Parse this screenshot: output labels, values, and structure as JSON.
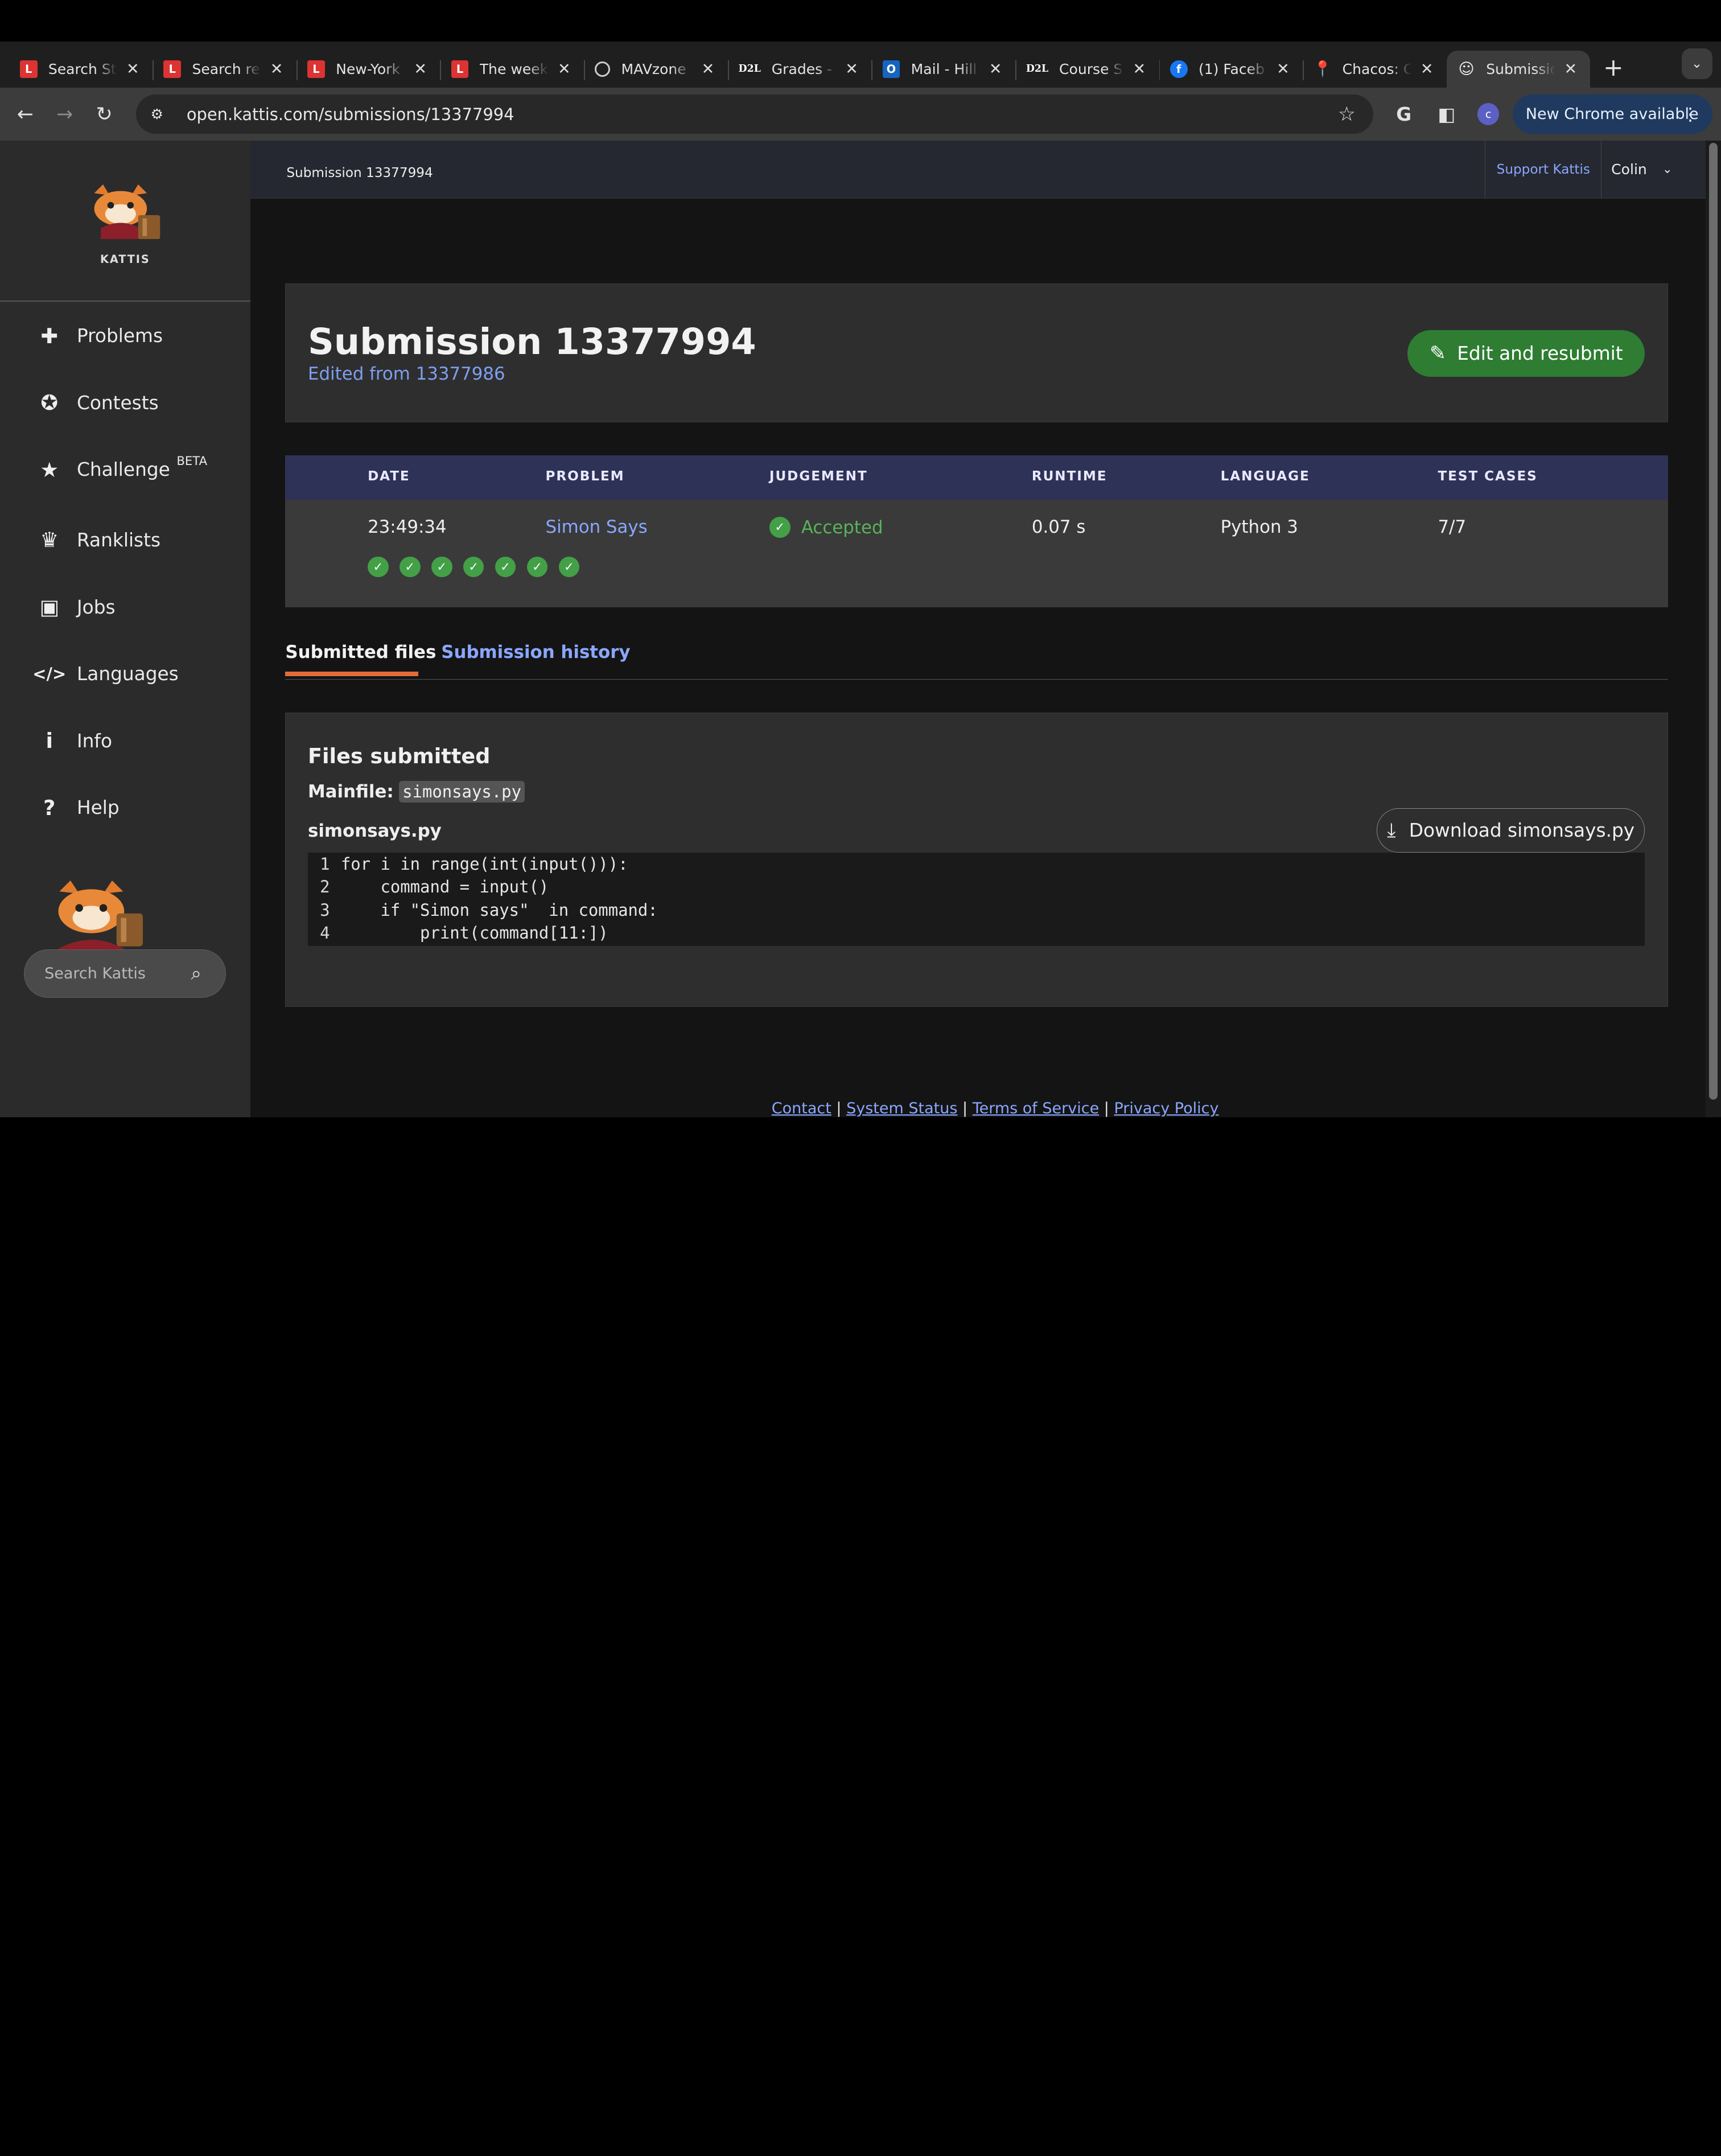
{
  "browser": {
    "tabs": [
      {
        "title": "Search St",
        "favicon": "LC"
      },
      {
        "title": "Search re",
        "favicon": "LC"
      },
      {
        "title": "New-York",
        "favicon": "LC"
      },
      {
        "title": "The week",
        "favicon": "LC"
      },
      {
        "title": "MAVzone",
        "favicon": "globe-icon"
      },
      {
        "title": "Grades -",
        "favicon": "D2L"
      },
      {
        "title": "Mail - Hill",
        "favicon": "outlook-icon"
      },
      {
        "title": "Course S",
        "favicon": "D2L"
      },
      {
        "title": "(1) Faceb",
        "favicon": "facebook-icon"
      },
      {
        "title": "Chacos: C",
        "favicon": "pin-icon"
      },
      {
        "title": "Submissio",
        "favicon": "kattis-icon",
        "active": true
      }
    ],
    "url": "open.kattis.com/submissions/13377994",
    "new_chrome_label": "New Chrome available",
    "profile_initial": "c"
  },
  "sidebar": {
    "logo_text": "KATTIS",
    "items": [
      {
        "label": "Problems",
        "icon": "puzzle-icon"
      },
      {
        "label": "Contests",
        "icon": "ribbon-icon"
      },
      {
        "label": "Challenge",
        "badge": "BETA",
        "icon": "star-icon"
      },
      {
        "label": "Ranklists",
        "icon": "trophy-icon"
      },
      {
        "label": "Jobs",
        "icon": "briefcase-icon"
      },
      {
        "label": "Languages",
        "icon": "code-icon"
      },
      {
        "label": "Info",
        "icon": "info-icon"
      },
      {
        "label": "Help",
        "icon": "question-icon"
      }
    ],
    "search_placeholder": "Search Kattis"
  },
  "header": {
    "breadcrumb": "Submission 13377994",
    "support": "Support Kattis",
    "user": "Colin"
  },
  "submission": {
    "title": "Submission 13377994",
    "edited_from": "Edited from 13377986",
    "edit_button": "Edit and resubmit",
    "columns": [
      "DATE",
      "PROBLEM",
      "JUDGEMENT",
      "RUNTIME",
      "LANGUAGE",
      "TEST CASES"
    ],
    "row": {
      "date": "23:49:34",
      "problem": "Simon Says",
      "judgement": "Accepted",
      "runtime": "0.07 s",
      "language": "Python 3",
      "test_cases": "7/7"
    },
    "test_case_results": [
      "accepted",
      "accepted",
      "accepted",
      "accepted",
      "accepted",
      "accepted",
      "accepted"
    ]
  },
  "tabs": {
    "submitted_files": "Submitted files",
    "submission_history": "Submission history"
  },
  "files": {
    "heading": "Files submitted",
    "mainfile_label": "Mainfile:",
    "mainfile": "simonsays.py",
    "filename": "simonsays.py",
    "download_label": "Download simonsays.py",
    "code_lines": [
      "for i in range(int(input())):",
      "    command = input()",
      "    if \"Simon says\"  in command:",
      "        print(command[11:])"
    ]
  },
  "footer": {
    "links": [
      "Contact",
      "System Status",
      "Terms of Service",
      "Privacy Policy"
    ]
  },
  "colors": {
    "accent_green": "#2e7d32",
    "link_blue": "#8aa7ff",
    "tab_underline": "#e36b3a",
    "table_header": "#2f3257"
  }
}
